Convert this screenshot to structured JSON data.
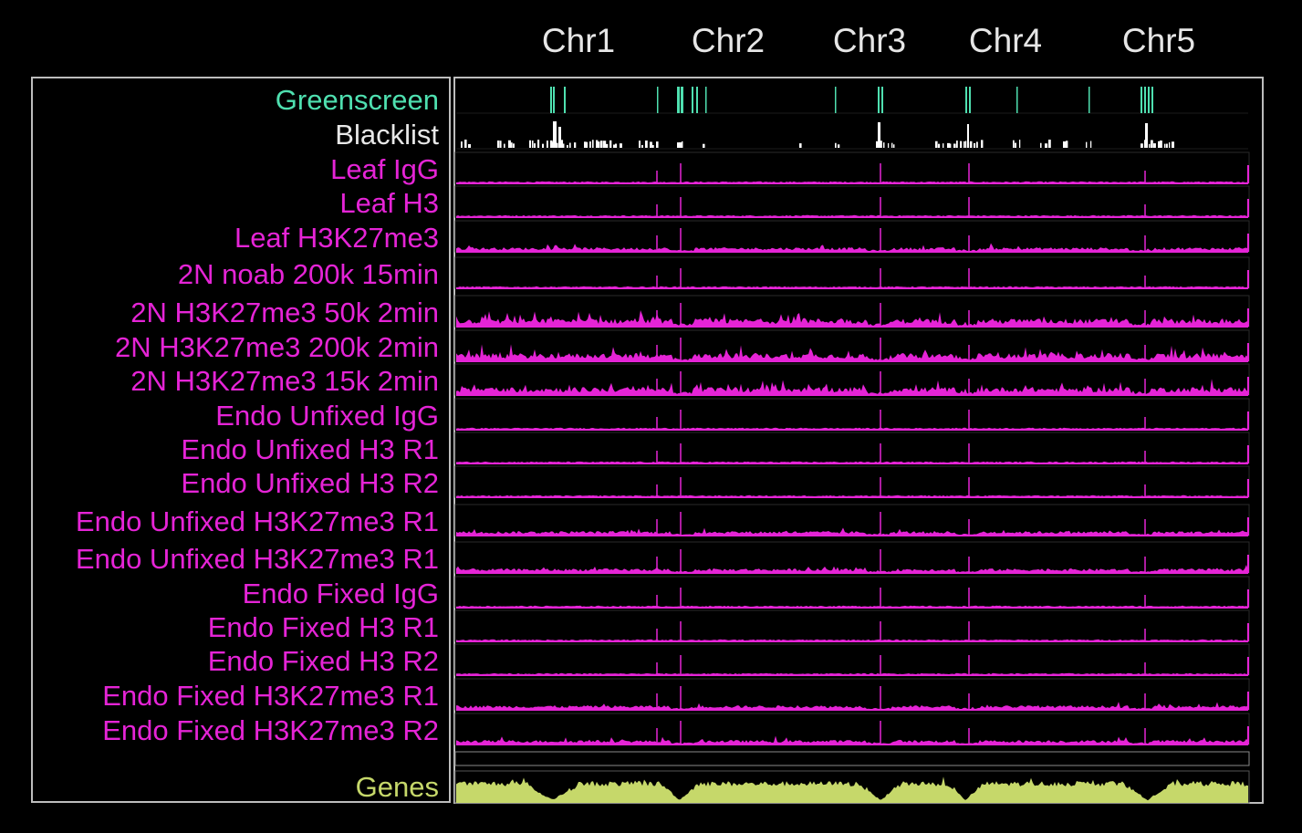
{
  "colors": {
    "greenscreen": "#4fe0b0",
    "blacklist": "#ffffff",
    "signal": "#e524d6",
    "genes": "#c6d86a",
    "frame": "#bdbdbd",
    "background": "#000000"
  },
  "chromosomes": [
    "Chr1",
    "Chr2",
    "Chr3",
    "Chr4",
    "Chr5"
  ],
  "tracks": [
    {
      "label": "Greenscreen",
      "kind": "greenscreen"
    },
    {
      "label": "Blacklist",
      "kind": "blacklist"
    },
    {
      "label": "Leaf IgG",
      "kind": "signal",
      "profile": "sparse"
    },
    {
      "label": "Leaf H3",
      "kind": "signal",
      "profile": "sparse"
    },
    {
      "label": "Leaf H3K27me3",
      "kind": "signal",
      "profile": "broad"
    },
    {
      "label": "2N noab 200k 15min",
      "kind": "signal",
      "profile": "sparse"
    },
    {
      "label": "2N H3K27me3 50k 2min",
      "kind": "signal",
      "profile": "dense"
    },
    {
      "label": "2N H3K27me3 200k 2min",
      "kind": "signal",
      "profile": "dense"
    },
    {
      "label": "2N H3K27me3 15k 2min",
      "kind": "signal",
      "profile": "dense"
    },
    {
      "label": "Endo Unfixed IgG",
      "kind": "signal",
      "profile": "sparse"
    },
    {
      "label": "Endo Unfixed H3 R1",
      "kind": "signal",
      "profile": "sparse"
    },
    {
      "label": "Endo Unfixed H3 R2",
      "kind": "signal",
      "profile": "sparse"
    },
    {
      "label": "Endo Unfixed H3K27me3 R1",
      "kind": "signal",
      "profile": "broad"
    },
    {
      "label": "Endo Unfixed H3K27me3 R1",
      "kind": "signal",
      "profile": "broad"
    },
    {
      "label": "Endo Fixed IgG",
      "kind": "signal",
      "profile": "sparse"
    },
    {
      "label": "Endo Fixed H3 R1",
      "kind": "signal",
      "profile": "sparse"
    },
    {
      "label": "Endo Fixed H3 R2",
      "kind": "signal",
      "profile": "sparse"
    },
    {
      "label": "Endo Fixed H3K27me3 R1",
      "kind": "signal",
      "profile": "broad"
    },
    {
      "label": "Endo Fixed H3K27me3 R2",
      "kind": "signal",
      "profile": "broad"
    },
    {
      "label": "Genes",
      "kind": "genes"
    }
  ]
}
